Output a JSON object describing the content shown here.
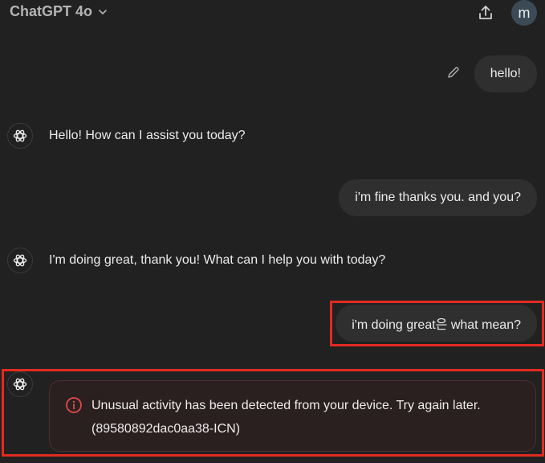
{
  "header": {
    "model_name": "ChatGPT 4o",
    "avatar_letter": "m",
    "icons": {
      "model_dropdown": "chevron-down-icon",
      "share": "share-upload-icon"
    }
  },
  "messages": [
    {
      "role": "user",
      "text": "hello!"
    },
    {
      "role": "assistant",
      "text": "Hello! How can I assist you today?"
    },
    {
      "role": "user",
      "text": "i'm fine thanks you. and you?"
    },
    {
      "role": "assistant",
      "text": "I'm doing great, thank you! What can I help you with today?"
    },
    {
      "role": "user",
      "text": "i'm doing great은 what mean?"
    },
    {
      "role": "assistant-error",
      "line1": "Unusual activity has been detected from your device. Try again later.",
      "line2": "(89580892dac0aa38-ICN)"
    }
  ],
  "colors": {
    "background": "#212121",
    "user_bubble": "#2f2f2f",
    "highlight": "#e22a20",
    "error_icon": "#e5484d",
    "error_card_bg": "#2b2020"
  }
}
